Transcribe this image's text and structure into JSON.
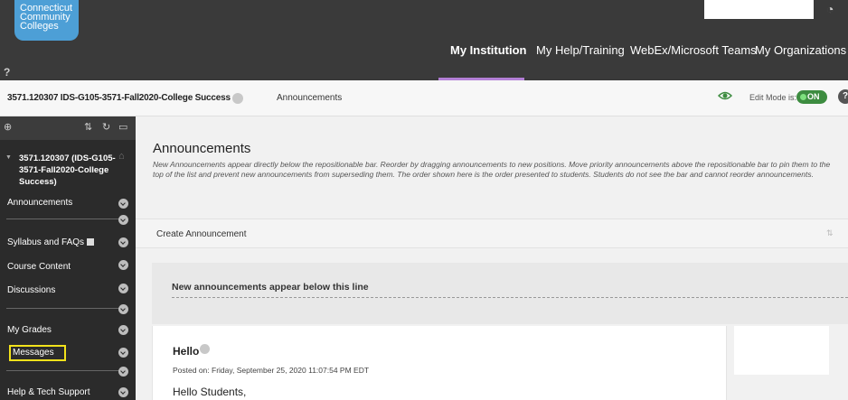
{
  "header": {
    "logo_lines": [
      "Connecticut",
      "Community",
      "Colleges"
    ],
    "help_glyph": "?",
    "nav": [
      {
        "label": "My Institution",
        "active": true
      },
      {
        "label": "My Help/Training",
        "active": false
      },
      {
        "label": "WebEx/Microsoft Teams",
        "active": false
      },
      {
        "label": "My Organizations",
        "active": false
      }
    ],
    "accent_color": "#b37fd6"
  },
  "coursebar": {
    "course_title": "3571.120307 IDS-G105-3571-Fall2020-College Success",
    "breadcrumb": "Announcements",
    "edit_mode_label": "Edit Mode is:",
    "edit_mode_value": "ON",
    "help_glyph": "?"
  },
  "sidebar": {
    "course_name": "3571.120307 (IDS-G105-3571-Fall2020-College Success)",
    "items": [
      {
        "label": "Announcements"
      },
      {
        "label": "Syllabus and FAQs"
      },
      {
        "label": "Course Content"
      },
      {
        "label": "Discussions"
      },
      {
        "label": "My Grades"
      },
      {
        "label": "Messages"
      },
      {
        "label": "Help & Tech Support"
      }
    ]
  },
  "main": {
    "title": "Announcements",
    "description": "New Announcements appear directly below the repositionable bar. Reorder by dragging announcements to new positions. Move priority announcements above the repositionable bar to pin them to the top of the list and prevent new announcements from superseding them. The order shown here is the order presented to students. Students do not see the bar and cannot reorder announcements.",
    "create_label": "Create Announcement",
    "repositionable_label": "New announcements appear below this line",
    "announcement": {
      "title": "Hello",
      "posted": "Posted on: Friday, September 25, 2020 11:07:54 PM EDT",
      "body": "Hello Students,"
    }
  }
}
